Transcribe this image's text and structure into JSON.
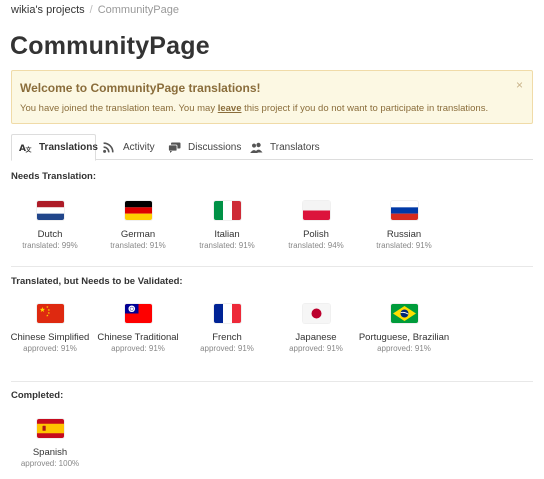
{
  "breadcrumb": {
    "parent": "wikia's projects",
    "separator": "/",
    "current": "CommunityPage"
  },
  "page_title": "CommunityPage",
  "alert": {
    "heading": "Welcome to CommunityPage translations!",
    "message_before": "You have joined the translation team. You may ",
    "link": "leave",
    "message_after": " this project if you do not want to participate in translations.",
    "close": "×"
  },
  "tabs": [
    {
      "label": "Translations",
      "icon": "translate-icon",
      "active": true
    },
    {
      "label": "Activity",
      "icon": "rss-icon",
      "active": false
    },
    {
      "label": "Discussions",
      "icon": "comments-icon",
      "active": false
    },
    {
      "label": "Translators",
      "icon": "users-icon",
      "active": false
    }
  ],
  "sections": [
    {
      "title": "Needs Translation:",
      "languages": [
        {
          "name": "Dutch",
          "stat": "translated: 99%",
          "flag": "nl"
        },
        {
          "name": "German",
          "stat": "translated: 91%",
          "flag": "de"
        },
        {
          "name": "Italian",
          "stat": "translated: 91%",
          "flag": "it"
        },
        {
          "name": "Polish",
          "stat": "translated: 94%",
          "flag": "pl"
        },
        {
          "name": "Russian",
          "stat": "translated: 91%",
          "flag": "ru"
        }
      ]
    },
    {
      "title": "Translated, but Needs to be Validated:",
      "languages": [
        {
          "name": "Chinese Simplified",
          "stat": "approved: 91%",
          "flag": "cn"
        },
        {
          "name": "Chinese Traditional",
          "stat": "approved: 91%",
          "flag": "tw"
        },
        {
          "name": "French",
          "stat": "approved: 91%",
          "flag": "fr"
        },
        {
          "name": "Japanese",
          "stat": "approved: 91%",
          "flag": "jp"
        },
        {
          "name": "Portuguese, Brazilian",
          "stat": "approved: 91%",
          "flag": "br"
        }
      ]
    },
    {
      "title": "Completed:",
      "languages": [
        {
          "name": "Spanish",
          "stat": "approved: 100%",
          "flag": "es"
        }
      ]
    }
  ],
  "colors": {
    "alert_bg": "#fcf8e3",
    "alert_text": "#8a6d3b",
    "muted": "#888888"
  }
}
